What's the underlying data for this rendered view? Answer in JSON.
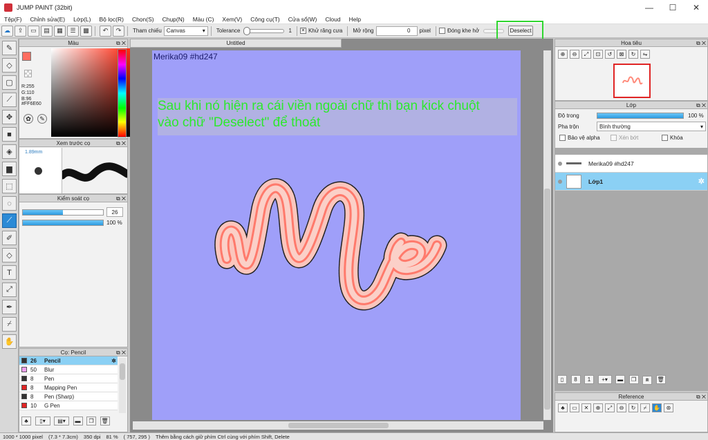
{
  "window": {
    "title": "JUMP PAINT (32bit)",
    "minimize": "—",
    "maximize": "☐",
    "close": "✕"
  },
  "menu": [
    "Tệp(F)",
    "Chỉnh sửa(E)",
    "Lớp(L)",
    "Bộ lọc(R)",
    "Chọn(S)",
    "Chụp(N)",
    "Màu (C)",
    "Xem(V)",
    "Công cụ(T)",
    "Cửa sổ(W)",
    "Cloud",
    "Help"
  ],
  "toolbar": {
    "target_label": "Tham chiếu",
    "target_value": "Canvas",
    "tolerance_label": "Tolerance",
    "tolerance_value": "1",
    "antialias_label": "Khử răng cưa",
    "expand_label": "Mở rộng",
    "expand_value": "0",
    "expand_unit": "pixel",
    "close_gap_label": "Đóng khe hở",
    "deselect_label": "Deselect"
  },
  "color_panel": {
    "title": "Màu",
    "r": "R:255",
    "g": "G:110",
    "b": "B:96",
    "hex": "#FF6E60",
    "main_color": "#ff6e60"
  },
  "brush_preview": {
    "title": "Xem trước cọ",
    "size": "1.89mm"
  },
  "brush_control": {
    "title": "Kiểm soát cọ",
    "size_value": "26",
    "size_ratio": 0.5,
    "opacity_value": "100 %",
    "opacity_ratio": 1.0
  },
  "pen_panel": {
    "title": "Cọ: Pencil",
    "items": [
      {
        "size": "26",
        "name": "Pencil",
        "color": "#333333",
        "active": true
      },
      {
        "size": "50",
        "name": "Blur",
        "color": "#f2a0f2",
        "active": false
      },
      {
        "size": "8",
        "name": "Pen",
        "color": "#333333",
        "active": false
      },
      {
        "size": "8",
        "name": "Mapping Pen",
        "color": "#e02424",
        "active": false
      },
      {
        "size": "8",
        "name": "Pen (Sharp)",
        "color": "#333333",
        "active": false
      },
      {
        "size": "10",
        "name": "G Pen",
        "color": "#e02424",
        "active": false
      }
    ]
  },
  "document": {
    "tab_title": "Untitled",
    "canvas_text": "Merika09  #hd247",
    "canvas_color": "#9f9ff9"
  },
  "annotation": {
    "line1": "Sau khi nó hiện ra cái viền ngoài chữ thì bạn kick chuột",
    "line2": "vào chữ \"Deselect\" để thoát"
  },
  "navigator": {
    "title": "Hoa tiêu"
  },
  "layer_panel": {
    "title": "Lớp",
    "opacity_label": "Độ trong",
    "opacity_value": "100 %",
    "blend_label": "Pha trộn",
    "blend_value": "Bình thường",
    "protect_alpha": "Bảo vệ alpha",
    "clipping": "Xén bớt",
    "lock": "Khóa",
    "layers": [
      {
        "name": "Merika09  #hd247",
        "active": false
      },
      {
        "name": "Lớp1",
        "active": true
      }
    ]
  },
  "reference": {
    "title": "Reference"
  },
  "status": {
    "size": "1000 * 1000 pixel",
    "physical": "(7.3 * 7.3cm)",
    "dpi": "350 dpi",
    "zoom": "81 %",
    "cursor": "( 757, 295 )",
    "hint": "Thêm bằng cách giữ phím Ctrl cùng với phím Shift, Delete"
  }
}
